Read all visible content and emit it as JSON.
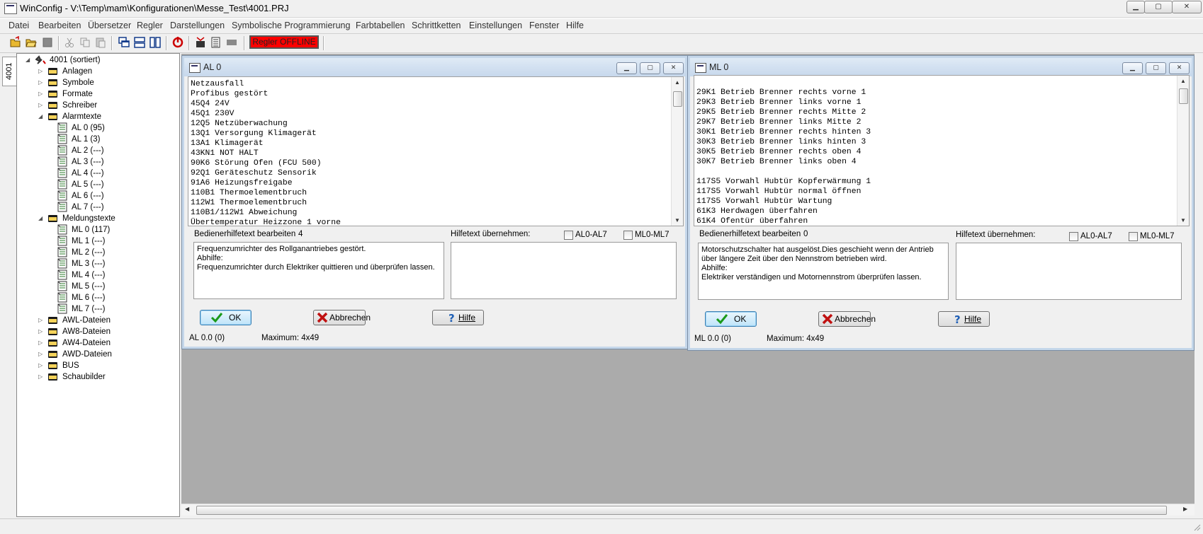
{
  "window": {
    "title": "WinConfig - V:\\Temp\\mam\\Konfigurationen\\Messe_Test\\4001.PRJ",
    "min": "▁",
    "max": "▢",
    "close": "✕"
  },
  "menu": [
    "Datei",
    "Bearbeiten",
    "Übersetzer",
    "Regler",
    "Darstellungen",
    "Symbolische Programmierung",
    "Farbtabellen",
    "Schrittketten",
    "Einstellungen",
    "Fenster",
    "Hilfe"
  ],
  "toolbar": {
    "status_badge": "Regler OFFLINE",
    "status_color": "#ff0000",
    "icons": [
      "open-folder-icon",
      "open-project-icon",
      "save-icon",
      "cut-icon",
      "copy-icon",
      "paste-icon",
      "cascade-windows-icon",
      "tile-horizontal-icon",
      "tile-vertical-icon",
      "connect-icon",
      "transfer-icon",
      "list-icon",
      "stop-icon"
    ]
  },
  "sidebar": {
    "tab_label": "4001",
    "root": "4001 (sortiert)",
    "nodes": [
      {
        "label": "Anlagen",
        "level": 1,
        "exp": "▷"
      },
      {
        "label": "Symbole",
        "level": 1,
        "exp": "▷"
      },
      {
        "label": "Formate",
        "level": 1,
        "exp": "▷"
      },
      {
        "label": "Schreiber",
        "level": 1,
        "exp": "▷"
      },
      {
        "label": "Alarmtexte",
        "level": 1,
        "exp": "◢"
      },
      {
        "label": "AL 0 (95)",
        "level": 2
      },
      {
        "label": "AL 1 (3)",
        "level": 2
      },
      {
        "label": "AL 2 (---)",
        "level": 2
      },
      {
        "label": "AL 3 (---)",
        "level": 2
      },
      {
        "label": "AL 4 (---)",
        "level": 2
      },
      {
        "label": "AL 5 (---)",
        "level": 2
      },
      {
        "label": "AL 6 (---)",
        "level": 2
      },
      {
        "label": "AL 7 (---)",
        "level": 2
      },
      {
        "label": "Meldungstexte",
        "level": 1,
        "exp": "◢"
      },
      {
        "label": "ML 0 (117)",
        "level": 2
      },
      {
        "label": "ML 1 (---)",
        "level": 2
      },
      {
        "label": "ML 2 (---)",
        "level": 2
      },
      {
        "label": "ML 3 (---)",
        "level": 2
      },
      {
        "label": "ML 4 (---)",
        "level": 2
      },
      {
        "label": "ML 5 (---)",
        "level": 2
      },
      {
        "label": "ML 6 (---)",
        "level": 2
      },
      {
        "label": "ML 7 (---)",
        "level": 2
      },
      {
        "label": "AWL-Dateien",
        "level": 1,
        "exp": "▷"
      },
      {
        "label": "AW8-Dateien",
        "level": 1,
        "exp": "▷"
      },
      {
        "label": "AW4-Dateien",
        "level": 1,
        "exp": "▷"
      },
      {
        "label": "AWD-Dateien",
        "level": 1,
        "exp": "▷"
      },
      {
        "label": "BUS",
        "level": 1,
        "exp": "▷"
      },
      {
        "label": "Schaubilder",
        "level": 1,
        "exp": "▷"
      }
    ]
  },
  "al_window": {
    "title": "AL 0",
    "lines": [
      "Netzausfall",
      "Profibus gestört",
      "45Q4 24V",
      "45Q1 230V",
      "12Q5 Netzüberwachung",
      "13Q1 Versorgung Klimagerät",
      "13A1 Klimagerät",
      "43KN1 NOT HALT",
      "90K6 Störung Ofen (FCU 500)",
      "92Q1 Geräteschutz Sensorik",
      "91A6 Heizungsfreigabe",
      "110B1 Thermoelementbruch",
      "112W1 Thermoelementbruch",
      "110B1/112W1 Abweichung",
      "Übertemperatur Heizzone 1 vorne"
    ],
    "help_label": "Bedienerhilfetext bearbeiten",
    "help_count": "4",
    "take_label": "Hilfetext übernehmen:",
    "cb1": "AL0-AL7",
    "cb2": "ML0-ML7",
    "help_text": "Frequenzumrichter des Rollganantriebes gestört.\nAbhilfe:\nFrequenzumrichter durch Elektriker quittieren und überprüfen lassen.",
    "ok": "OK",
    "cancel": "Abbrechen",
    "help": "Hilfe",
    "status_pos": "AL 0.0 (0)",
    "status_max": "Maximum: 4x49"
  },
  "ml_window": {
    "title": "ML 0",
    "lines": [
      "",
      "29K1 Betrieb Brenner rechts vorne 1",
      "29K3 Betrieb Brenner links vorne 1",
      "29K5 Betrieb Brenner rechts Mitte 2",
      "29K7 Betrieb Brenner links Mitte 2",
      "30K1 Betrieb Brenner rechts hinten 3",
      "30K3 Betrieb Brenner links hinten 3",
      "30K5 Betrieb Brenner rechts oben 4",
      "30K7 Betrieb Brenner links oben 4",
      "",
      "117S5 Vorwahl Hubtür Kopferwärmung 1",
      "117S5 Vorwahl Hubtür normal öffnen",
      "117S5 Vorwahl Hubtür Wartung",
      "61K3 Herdwagen überfahren",
      "61K4 Ofentür überfahren"
    ],
    "help_label": "Bedienerhilfetext bearbeiten",
    "help_count": "0",
    "take_label": "Hilfetext übernehmen:",
    "cb1": "AL0-AL7",
    "cb2": "ML0-ML7",
    "help_text": "Motorschutzschalter hat ausgelöst.Dies geschieht wenn der Antrieb über längere Zeit über den Nennstrom betrieben wird.\nAbhilfe:\nElektriker verständigen und Motornennstrom überprüfen lassen.",
    "ok": "OK",
    "cancel": "Abbrechen",
    "help": "Hilfe",
    "status_pos": "ML 0.0 (0)",
    "status_max": "Maximum: 4x49"
  }
}
